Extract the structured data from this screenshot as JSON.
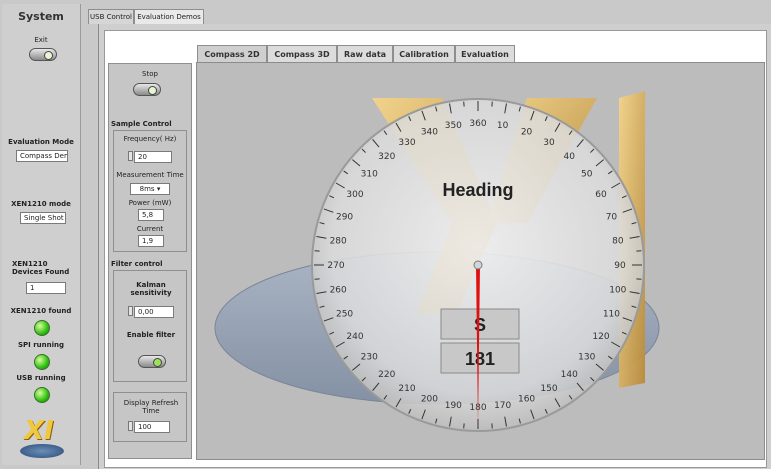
{
  "system": {
    "title": "System",
    "exit_label": "Exit",
    "evaluation_mode_label": "Evaluation Mode",
    "evaluation_mode_value": "Compass Demo",
    "xen_mode_label": "XEN1210 mode",
    "xen_mode_value": "Single Shot",
    "devices_found_label": "XEN1210 Devices Found",
    "devices_found_value": "1",
    "xen_found_label": "XEN1210 found",
    "spi_running_label": "SPI running",
    "usb_running_label": "USB running",
    "logo_text": "XI",
    "indicators": {
      "xen_found": true,
      "spi_running": true,
      "usb_running": true
    }
  },
  "top_tabs": [
    {
      "label": "USB Control"
    },
    {
      "label": "Evaluation Demos"
    }
  ],
  "sub_tabs": [
    {
      "label": "Compass 2D"
    },
    {
      "label": "Compass 3D"
    },
    {
      "label": "Raw data"
    },
    {
      "label": "Calibration"
    },
    {
      "label": "Evaluation"
    }
  ],
  "controls": {
    "stop_label": "Stop",
    "sample_control": {
      "title": "Sample Control",
      "frequency_label": "Frequency( Hz)",
      "frequency_value": "20",
      "measurement_time_label": "Measurement Time",
      "measurement_time_value": "8ms",
      "power_label": "Power (mW)",
      "power_value": "5,8",
      "current_label": "Current",
      "current_value": "1,9"
    },
    "filter_control": {
      "title": "Filter control",
      "kalman_label": "Kalman sensitivity",
      "kalman_value": "0,00",
      "enable_filter_label": "Enable filter"
    },
    "display_refresh": {
      "label": "Display Refresh Time",
      "value": "100"
    }
  },
  "compass": {
    "heading_label": "Heading",
    "direction": "S",
    "heading_value": "181",
    "needle_color": "#e01010",
    "dial_numbers": [
      "360",
      "10",
      "20",
      "30",
      "40",
      "50",
      "60",
      "70",
      "80",
      "90",
      "100",
      "110",
      "120",
      "130",
      "140",
      "150",
      "160",
      "170",
      "180",
      "190",
      "200",
      "210",
      "220",
      "230",
      "240",
      "250",
      "260",
      "270",
      "280",
      "290",
      "300",
      "310",
      "320",
      "330",
      "340",
      "350"
    ]
  }
}
